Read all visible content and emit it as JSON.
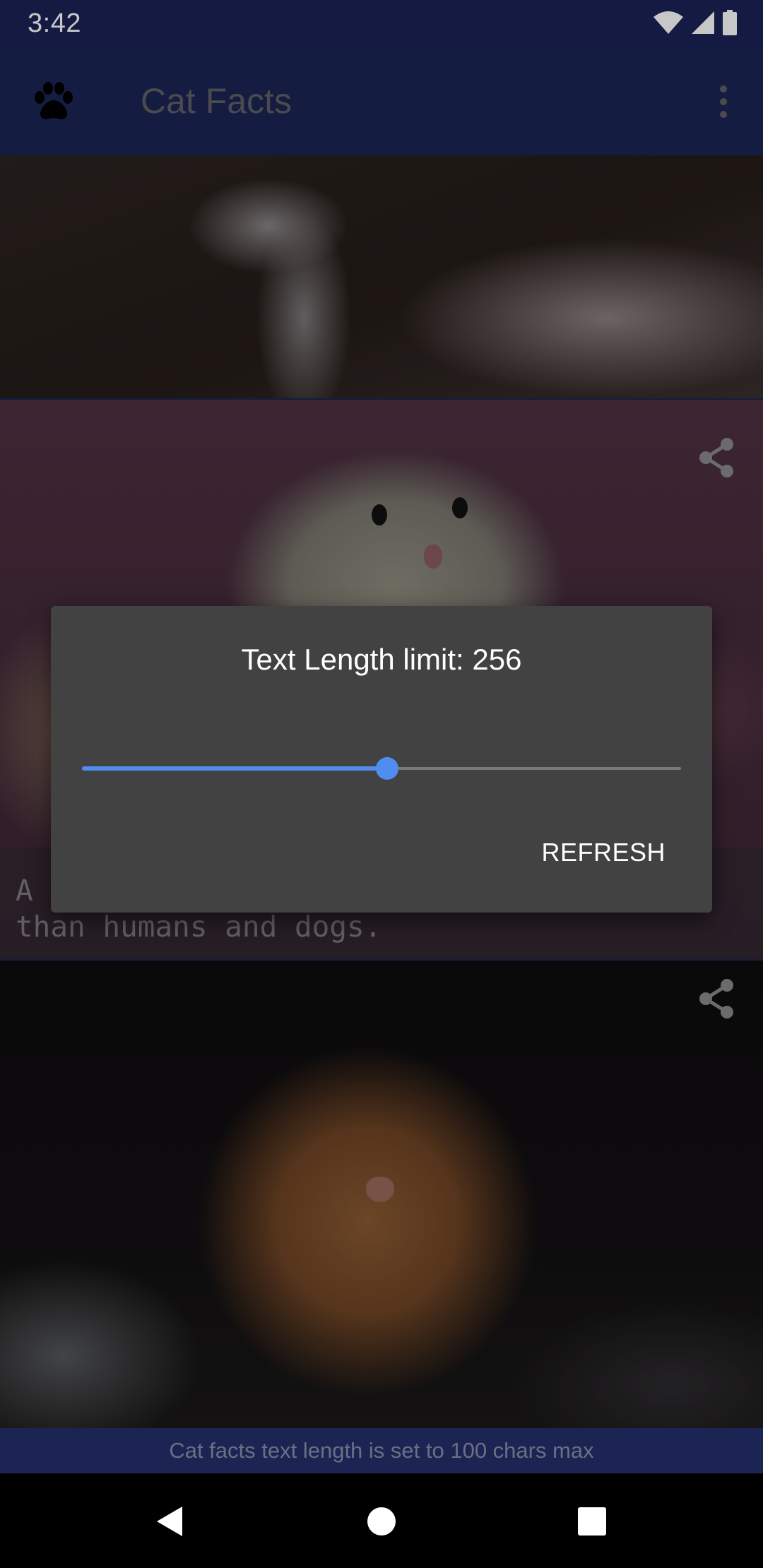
{
  "status_bar": {
    "time": "3:42",
    "icons": [
      "wifi-icon",
      "cell-signal-icon",
      "battery-icon"
    ]
  },
  "app_bar": {
    "icon": "paw-icon",
    "title": "Cat Facts",
    "menu_icon": "more-vert-icon"
  },
  "feed": {
    "cards": [
      {
        "image": "cat-paws-photo",
        "text": ""
      },
      {
        "image": "cat-in-bunny-costume-photo",
        "share_icon": "share-icon",
        "text": "A\nthan humans and dogs."
      },
      {
        "image": "ginger-cat-photo",
        "share_icon": "share-icon",
        "text": ""
      }
    ]
  },
  "dialog": {
    "title": "Text Length limit: 256",
    "slider_value": 0.51,
    "button_label": "REFRESH"
  },
  "toast": {
    "text": "Cat facts text length is set to 100 chars max"
  },
  "nav_bar": {
    "back": "back-icon",
    "home": "home-icon",
    "recents": "recents-icon"
  },
  "colors": {
    "primary": "#1c2454",
    "accent": "#4f8ef0",
    "dialog_bg": "#424242"
  }
}
